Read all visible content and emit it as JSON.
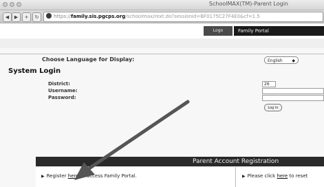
{
  "window": {
    "title": "SchoolMAX(TM)-Parent Login"
  },
  "toolbar": {
    "back": "◀",
    "forward": "▶",
    "add": "+",
    "url_prefix": "https://",
    "url_host": "family.sis.pgcps.org",
    "url_rest": "/schoolmax/rext.do?sessionid=BF0175C27F4E0&cf=1.5"
  },
  "site": {
    "logo_tab": "Logo",
    "portal": "Family Portal"
  },
  "login": {
    "language_label": "Choose Language for Display:",
    "language_value": "English",
    "heading": "System Login",
    "district_label": "District:",
    "district_value": "26",
    "username_label": "Username:",
    "password_label": "Password:",
    "login_button": "Log In"
  },
  "registration": {
    "title": "Parent Account Registration",
    "register_pre": "Register ",
    "register_link": "here",
    "register_post": " to access Family Portal.",
    "reset_pre": "Please click ",
    "reset_link": "here",
    "reset_post": " to reset"
  },
  "icons": {
    "bullet": "triangle-right-icon",
    "annotation": "arrow-annotation"
  }
}
